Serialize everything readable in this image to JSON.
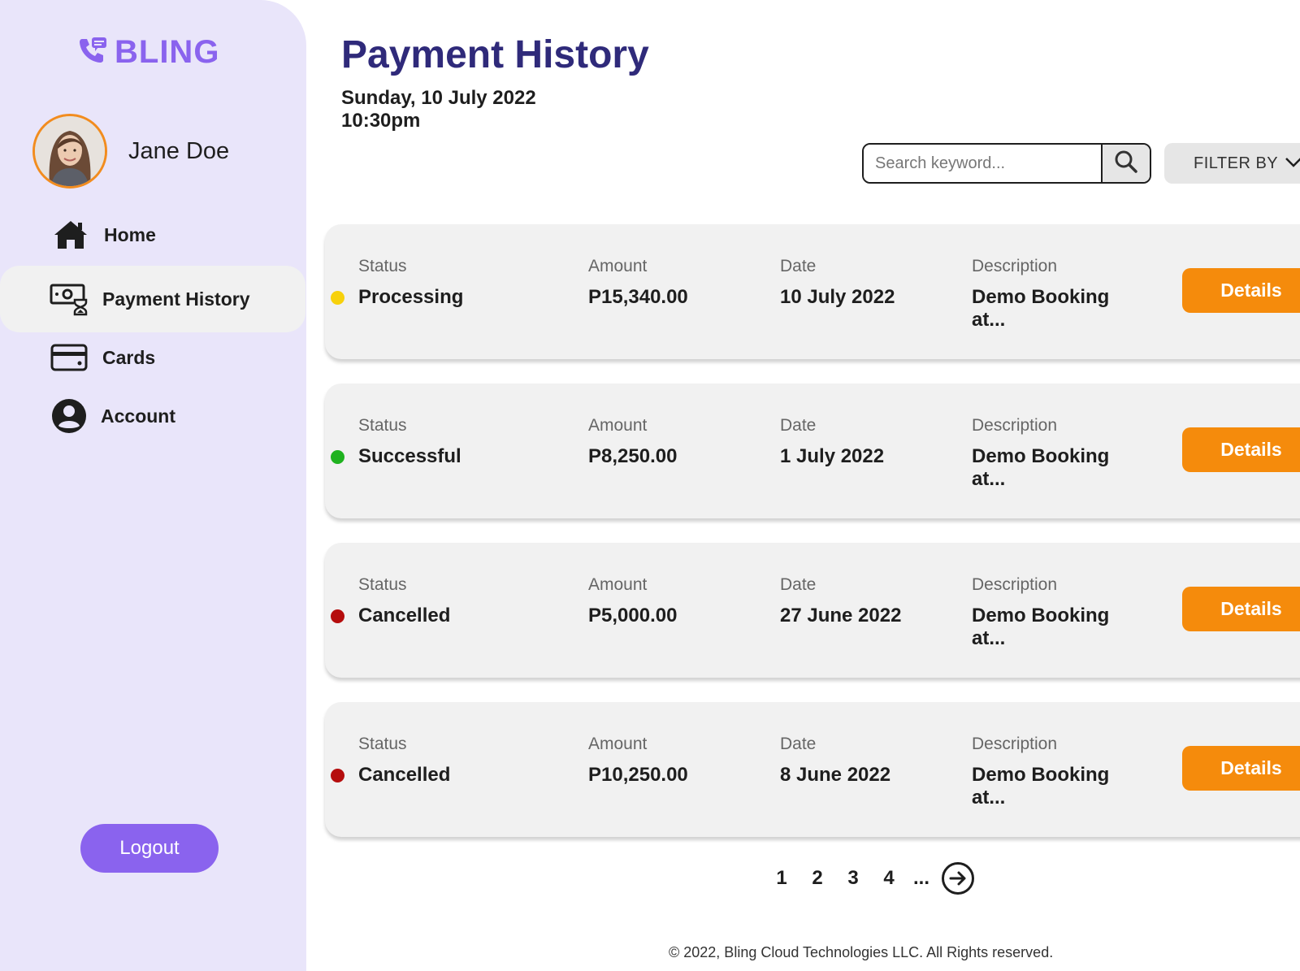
{
  "brand": {
    "name": "BLING",
    "color": "#8a63ee"
  },
  "user": {
    "name": "Jane Doe"
  },
  "sidebar": {
    "items": [
      {
        "label": "Home",
        "icon": "home-icon"
      },
      {
        "label": "Payment History",
        "icon": "payment-history-icon",
        "active": true
      },
      {
        "label": "Cards",
        "icon": "credit-card-icon"
      },
      {
        "label": "Account",
        "icon": "account-icon"
      }
    ],
    "logout_label": "Logout"
  },
  "header": {
    "title": "Payment History",
    "date": "Sunday, 10 July 2022",
    "time": "10:30pm"
  },
  "search": {
    "placeholder": "Search keyword...",
    "value": ""
  },
  "filter": {
    "label": "FILTER BY"
  },
  "columns": {
    "status": "Status",
    "amount": "Amount",
    "date": "Date",
    "description": "Description"
  },
  "payments": [
    {
      "status": "Processing",
      "status_color": "#f7d10c",
      "amount": "P15,340.00",
      "date": "10 July 2022",
      "description_line1": "Demo Booking",
      "description_line2": "at...",
      "action": "Details"
    },
    {
      "status": "Successful",
      "status_color": "#1fb21f",
      "amount": "P8,250.00",
      "date": "1 July 2022",
      "description_line1": "Demo Booking",
      "description_line2": "at...",
      "action": "Details"
    },
    {
      "status": "Cancelled",
      "status_color": "#b50d0d",
      "amount": "P5,000.00",
      "date": "27 June 2022",
      "description_line1": "Demo Booking",
      "description_line2": "at...",
      "action": "Details"
    },
    {
      "status": "Cancelled",
      "status_color": "#b50d0d",
      "amount": "P10,250.00",
      "date": "8 June 2022",
      "description_line1": "Demo Booking",
      "description_line2": "at...",
      "action": "Details"
    }
  ],
  "pagination": {
    "pages": [
      "1",
      "2",
      "3",
      "4"
    ],
    "ellipsis": "...",
    "next_icon": "arrow-right-circle-icon"
  },
  "footer": {
    "text": "© 2022, Bling Cloud Technologies LLC. All Rights reserved."
  },
  "colors": {
    "accent_orange": "#f58b0c",
    "title_navy": "#2f2a7a",
    "sidebar_bg": "#e9e5fa"
  }
}
